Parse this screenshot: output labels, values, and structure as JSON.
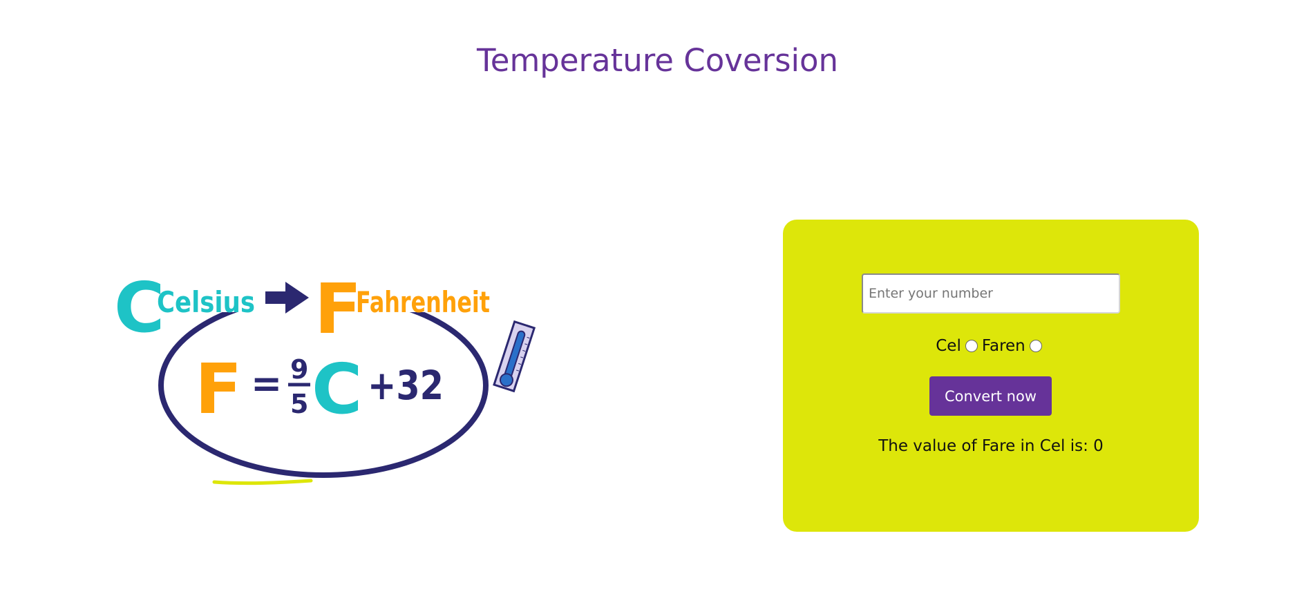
{
  "page": {
    "title": "Temperature Coversion"
  },
  "illustration": {
    "text_celsius": "Celsius",
    "text_fahrenheit": "Fahrenheit",
    "formula_F": "F",
    "formula_equals": "=",
    "formula_num": "9",
    "formula_den": "5",
    "formula_C": "C",
    "formula_plus32": "+32"
  },
  "form": {
    "input": {
      "placeholder": "Enter your number",
      "value": ""
    },
    "radio_options": [
      {
        "label": "Cel",
        "selected": false
      },
      {
        "label": "Faren",
        "selected": false
      }
    ],
    "convert_button_label": "Convert now",
    "result_text": "The value of Fare in Cel is: 0"
  },
  "colors": {
    "accent": "#663399",
    "card_background": "#dde60a",
    "celsius_teal": "#1ec3c6",
    "fahrenheit_orange": "#ffa10a",
    "navy": "#2b2870"
  }
}
